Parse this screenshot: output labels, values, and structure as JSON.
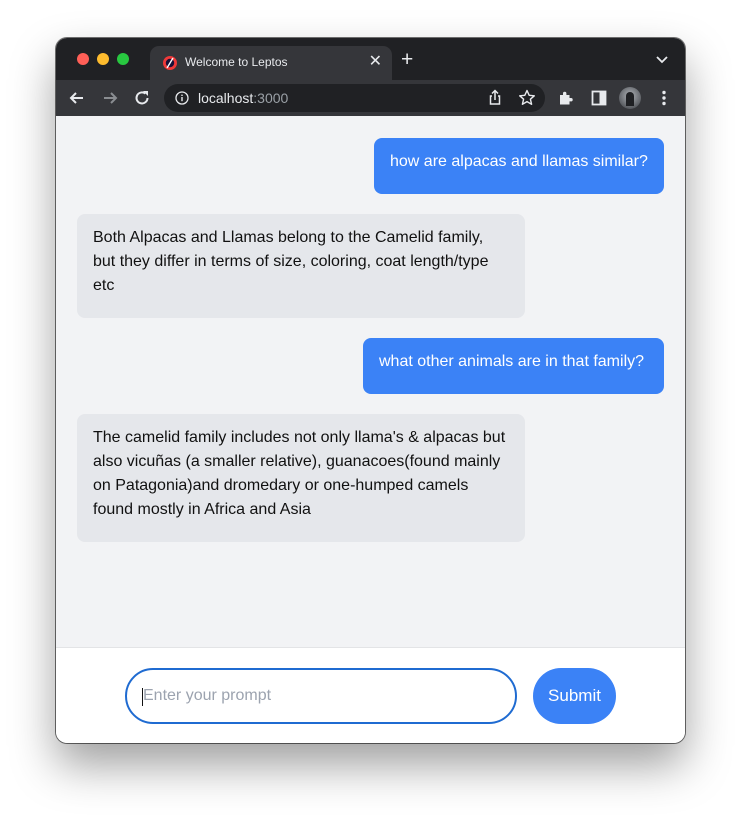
{
  "browser": {
    "tab_title": "Welcome to Leptos",
    "tab_close": "✕",
    "new_tab": "+",
    "url_host": "localhost",
    "url_port": ":3000"
  },
  "messages": [
    {
      "role": "user",
      "text": "how are alpacas and llamas similar?"
    },
    {
      "role": "assistant",
      "text": "Both Alpacas and Llamas belong to the Camelid family, but they differ in terms of size, coloring, coat length/type etc"
    },
    {
      "role": "user",
      "text": "what other animals are in that family?"
    },
    {
      "role": "assistant",
      "text": "The camelid family includes not only llama's & alpacas but also vicuñas (a smaller relative), guanacoes(found mainly on Patagonia)and dromedary or one-humped camels found mostly in Africa and Asia"
    }
  ],
  "composer": {
    "placeholder": "Enter your prompt",
    "value": "",
    "submit_label": "Submit"
  },
  "colors": {
    "user_bubble": "#3b82f6",
    "assistant_bubble": "#e5e7eb",
    "chat_background": "#f2f3f5",
    "input_border": "#1f6bd1"
  }
}
